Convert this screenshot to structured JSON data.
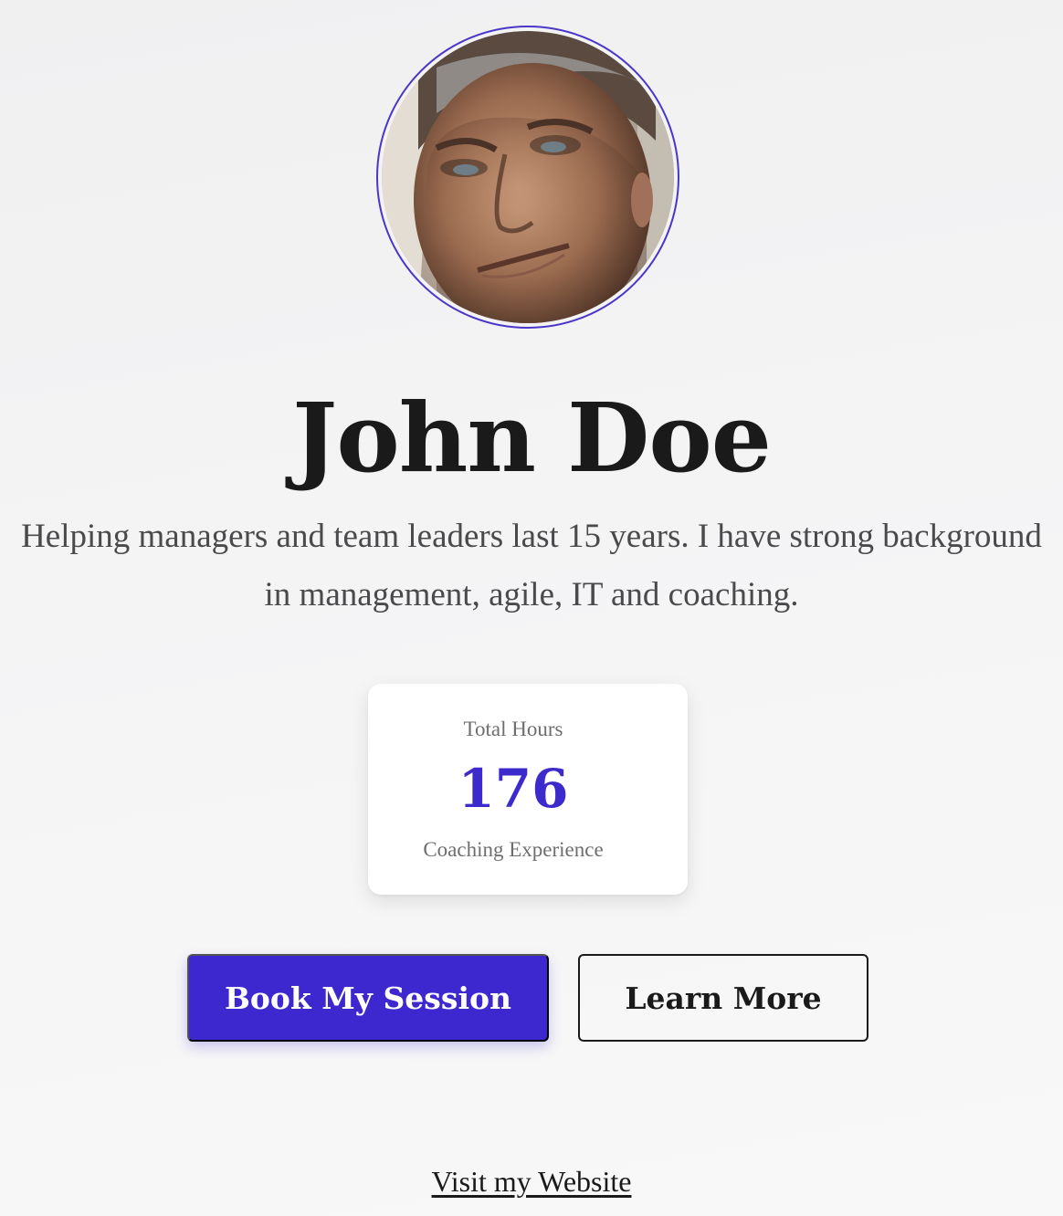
{
  "profile": {
    "name": "John Doe",
    "bio": "Helping managers and team leaders last 15 years. I have strong background in management, agile, IT and coaching.",
    "avatar_icon": "portrait-photo",
    "accent_color": "#3d28cf"
  },
  "stats": {
    "label": "Total Hours",
    "value": "176",
    "caption": "Coaching Experience"
  },
  "actions": {
    "primary_label": "Book My Session",
    "secondary_label": "Learn More"
  },
  "footer": {
    "website_link": "Visit my Website"
  }
}
